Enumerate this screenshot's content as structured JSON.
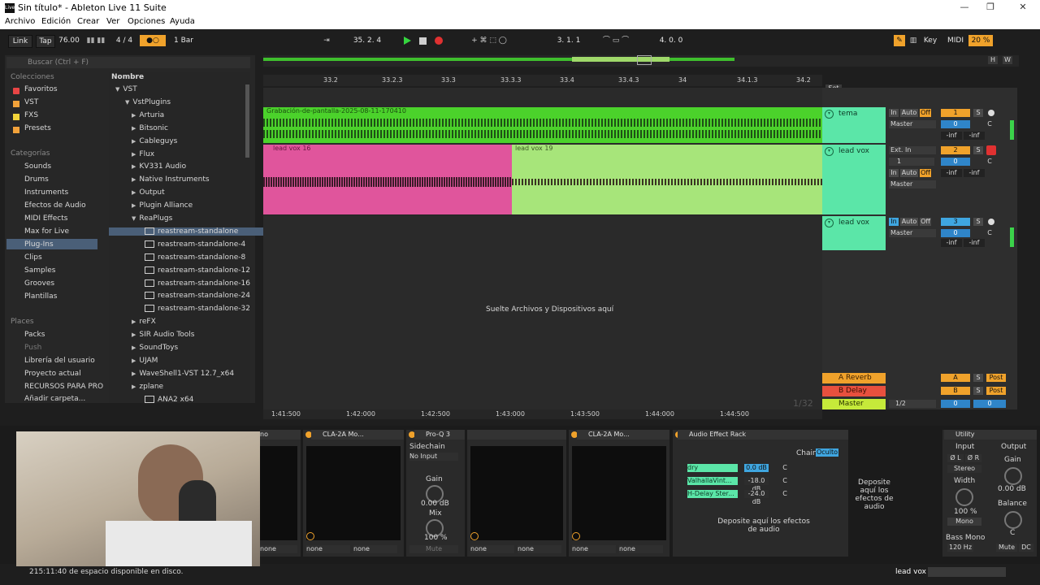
{
  "window": {
    "title": "Sin título* - Ableton Live 11 Suite",
    "logo": "Live",
    "minimize": "—",
    "maximize": "❐",
    "close": "✕"
  },
  "menu": [
    "Archivo",
    "Edición",
    "Crear",
    "Ver",
    "Opciones",
    "Ayuda"
  ],
  "transport": {
    "link": "Link",
    "tap": "Tap",
    "tempo": "76.00",
    "signature": "4 / 4",
    "metronome": "●○",
    "quantize": "1 Bar",
    "position": "35.  2.  4",
    "loop_start": "3.  1.  1",
    "loop_length": "4.  0.  0",
    "key": "Key",
    "midi": "MIDI",
    "cpu": "20 %"
  },
  "browser": {
    "search_placeholder": "Buscar (Ctrl + F)",
    "collections_title": "Colecciones",
    "collections": [
      {
        "label": "Favoritos",
        "color": "#e84545"
      },
      {
        "label": "VST",
        "color": "#f2a23a"
      },
      {
        "label": "FXS",
        "color": "#f2d43a"
      },
      {
        "label": "Presets",
        "color": "#f2a23a"
      }
    ],
    "categories_title": "Categorías",
    "categories": [
      "Sounds",
      "Drums",
      "Instruments",
      "Efectos de Audio",
      "MIDI Effects",
      "Max for Live",
      "Plug-Ins",
      "Clips",
      "Samples",
      "Grooves",
      "Plantillas"
    ],
    "places_title": "Places",
    "places": [
      "Packs",
      "Push",
      "Librería del usuario",
      "Proyecto actual",
      "RECURSOS PARA PRO",
      "Añadir carpeta..."
    ],
    "name_header": "Nombre",
    "tree": [
      {
        "label": "VST",
        "level": 0,
        "arrow": "▼"
      },
      {
        "label": "VstPlugins",
        "level": 1,
        "arrow": "▼"
      },
      {
        "label": "Arturia",
        "level": 2,
        "arrow": "▶"
      },
      {
        "label": "Bitsonic",
        "level": 2,
        "arrow": "▶"
      },
      {
        "label": "Cableguys",
        "level": 2,
        "arrow": "▶"
      },
      {
        "label": "Flux",
        "level": 2,
        "arrow": "▶"
      },
      {
        "label": "KV331 Audio",
        "level": 2,
        "arrow": "▶"
      },
      {
        "label": "Native Instruments",
        "level": 2,
        "arrow": "▶"
      },
      {
        "label": "Output",
        "level": 2,
        "arrow": "▶"
      },
      {
        "label": "Plugin Alliance",
        "level": 2,
        "arrow": "▶"
      },
      {
        "label": "ReaPlugs",
        "level": 2,
        "arrow": "▼"
      },
      {
        "label": "reastream-standalone",
        "level": 3,
        "arrow": ""
      },
      {
        "label": "reastream-standalone-4",
        "level": 3,
        "arrow": ""
      },
      {
        "label": "reastream-standalone-8",
        "level": 3,
        "arrow": ""
      },
      {
        "label": "reastream-standalone-12",
        "level": 3,
        "arrow": ""
      },
      {
        "label": "reastream-standalone-16",
        "level": 3,
        "arrow": ""
      },
      {
        "label": "reastream-standalone-24",
        "level": 3,
        "arrow": ""
      },
      {
        "label": "reastream-standalone-32",
        "level": 3,
        "arrow": ""
      },
      {
        "label": "reFX",
        "level": 2,
        "arrow": "▶"
      },
      {
        "label": "SIR Audio Tools",
        "level": 2,
        "arrow": "▶"
      },
      {
        "label": "SoundToys",
        "level": 2,
        "arrow": "▶"
      },
      {
        "label": "UJAM",
        "level": 2,
        "arrow": "▶"
      },
      {
        "label": "WaveShell1-VST 12.7_x64",
        "level": 2,
        "arrow": "▶"
      },
      {
        "label": "zplane",
        "level": 2,
        "arrow": "▶"
      },
      {
        "label": "ANA2 x64",
        "level": 3,
        "arrow": ""
      }
    ]
  },
  "ruler": [
    "33.2",
    "33.2.3",
    "33.3",
    "33.3.3",
    "33.4",
    "33.4.3",
    "34",
    "34.1.3",
    "34.2"
  ],
  "time_ruler": [
    "1:41:500",
    "1:42:000",
    "1:42:500",
    "1:43:000",
    "1:43:500",
    "1:44:000",
    "1:44:500"
  ],
  "tracks": [
    {
      "name": "tema",
      "clip": "Grabación-de-pantalla-2025-08-11-170410",
      "in": "In",
      "auto": "Auto",
      "off": "Off",
      "route": "Master",
      "num": "1",
      "vol": "0",
      "pan": "C",
      "s": "S",
      "inf1": "-inf",
      "inf2": "-inf"
    },
    {
      "name": "lead vox",
      "clip_a": "lead vox 16",
      "clip_b": "lead vox 19",
      "input": "Ext. In",
      "chan": "1",
      "in": "In",
      "auto": "Auto",
      "off": "Off",
      "route": "Master",
      "num": "2",
      "vol": "0",
      "pan": "C",
      "s": "S",
      "inf1": "-inf",
      "inf2": "-inf"
    },
    {
      "name": "lead vox",
      "in": "In",
      "auto": "Auto",
      "off": "Off",
      "route": "Master",
      "num": "3",
      "vol": "0",
      "pan": "C",
      "s": "S",
      "inf1": "-inf",
      "inf2": "-inf"
    }
  ],
  "drop_hint": "Suelte Archivos y Dispositivos aquí",
  "returns": [
    {
      "name": "A Reverb",
      "letter": "A",
      "s": "S",
      "post": "Post"
    },
    {
      "name": "B Delay",
      "letter": "B",
      "s": "S",
      "post": "Post"
    }
  ],
  "master": {
    "name": "Master",
    "route": "1/2",
    "vol": "0",
    "pan": "0"
  },
  "set_label": "Set",
  "page_counter": "1/32",
  "devices": {
    "d0": {
      "title": "no",
      "in": "none",
      "out": "none"
    },
    "d1": {
      "title": "CLA-2A Mo...",
      "in": "none",
      "out": "none"
    },
    "proq": {
      "title": "Pro-Q 3",
      "sidechain": "Sidechain",
      "no_input": "No Input",
      "gain": "Gain",
      "gain_val": "0.00 dB",
      "mix": "Mix",
      "mix_val": "100 %",
      "mute": "Mute"
    },
    "d3": {
      "title": "none",
      "out": "none"
    },
    "d4": {
      "title": "CLA-2A Mo...",
      "in": "none",
      "out": "none"
    },
    "rack": {
      "title": "Audio Effect Rack",
      "chain": "Chain",
      "hidden": "Oculto",
      "chains": [
        {
          "name": "dry",
          "vol": "0.0 dB",
          "pan": "C"
        },
        {
          "name": "ValhallaVint...",
          "vol": "-18.0 dB",
          "pan": "C"
        },
        {
          "name": "H-Delay Ster...",
          "vol": "-24.0 dB",
          "pan": "C"
        }
      ],
      "drop_chains": "Deposite aquí los efectos de audio",
      "drop_effects": "Deposite aquí los efectos de audio"
    },
    "utility": {
      "title": "Utility",
      "input": "Input",
      "output": "Output",
      "l": "Ø L",
      "r": "Ø R",
      "stereo": "Stereo",
      "width": "Width",
      "width_val": "100 %",
      "mono": "Mono",
      "gain": "Gain",
      "gain_val": "0.00 dB",
      "balance": "Balance",
      "balance_val": "C",
      "bass_mono": "Bass Mono",
      "freq": "120 Hz",
      "mute": "Mute",
      "dc": "DC"
    }
  },
  "status": {
    "disk": "215:11:40 de espacio disponible en disco.",
    "selected_track": "lead vox"
  },
  "colors": {
    "green_clip": "#4bd22b",
    "pink_clip": "#e0559c",
    "light_green_clip": "#a7e57a",
    "track_head": "#5be6a8",
    "orange": "#f0a22b",
    "record": "#e03131"
  }
}
